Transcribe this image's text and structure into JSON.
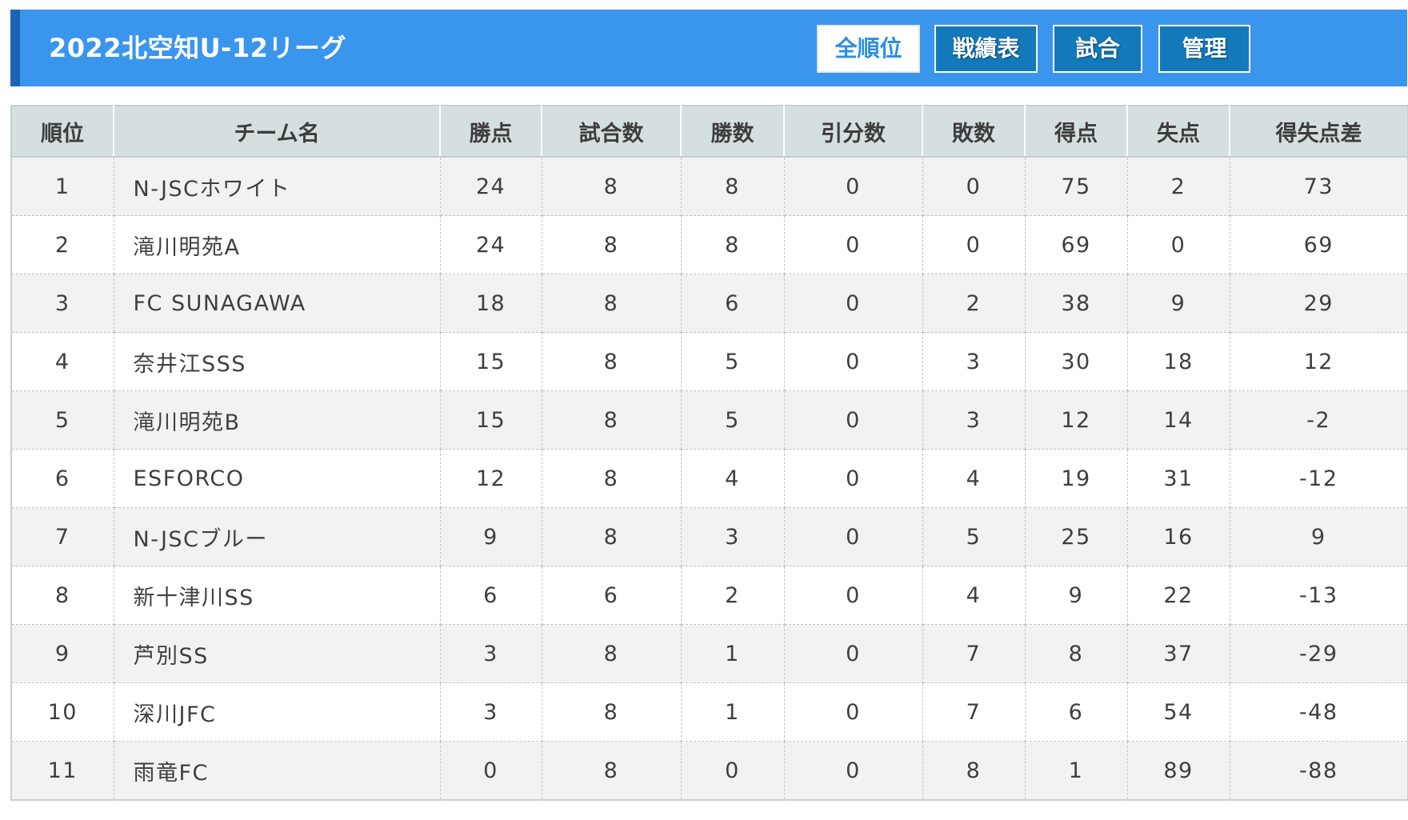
{
  "header": {
    "title": "2022北空知U-12リーグ",
    "buttons": [
      {
        "label": "全順位",
        "active": true
      },
      {
        "label": "戦績表",
        "active": false
      },
      {
        "label": "試合",
        "active": false
      },
      {
        "label": "管理",
        "active": false
      }
    ],
    "colors": {
      "bar": "#3a95ec",
      "accent": "#1c63b8",
      "button": "#1479b8"
    }
  },
  "table": {
    "columns": [
      "順位",
      "チーム名",
      "勝点",
      "試合数",
      "勝数",
      "引分数",
      "敗数",
      "得点",
      "失点",
      "得失点差"
    ],
    "rows": [
      [
        "1",
        "N-JSCホワイト",
        "24",
        "8",
        "8",
        "0",
        "0",
        "75",
        "2",
        "73"
      ],
      [
        "2",
        "滝川明苑A",
        "24",
        "8",
        "8",
        "0",
        "0",
        "69",
        "0",
        "69"
      ],
      [
        "3",
        "FC SUNAGAWA",
        "18",
        "8",
        "6",
        "0",
        "2",
        "38",
        "9",
        "29"
      ],
      [
        "4",
        "奈井江SSS",
        "15",
        "8",
        "5",
        "0",
        "3",
        "30",
        "18",
        "12"
      ],
      [
        "5",
        "滝川明苑B",
        "15",
        "8",
        "5",
        "0",
        "3",
        "12",
        "14",
        "-2"
      ],
      [
        "6",
        "ESFORCO",
        "12",
        "8",
        "4",
        "0",
        "4",
        "19",
        "31",
        "-12"
      ],
      [
        "7",
        "N-JSCブルー",
        "9",
        "8",
        "3",
        "0",
        "5",
        "25",
        "16",
        "9"
      ],
      [
        "8",
        "新十津川SS",
        "6",
        "6",
        "2",
        "0",
        "4",
        "9",
        "22",
        "-13"
      ],
      [
        "9",
        "芦別SS",
        "3",
        "8",
        "1",
        "0",
        "7",
        "8",
        "37",
        "-29"
      ],
      [
        "10",
        "深川JFC",
        "3",
        "8",
        "1",
        "0",
        "7",
        "6",
        "54",
        "-48"
      ],
      [
        "11",
        "雨竜FC",
        "0",
        "8",
        "0",
        "0",
        "8",
        "1",
        "89",
        "-88"
      ]
    ]
  }
}
